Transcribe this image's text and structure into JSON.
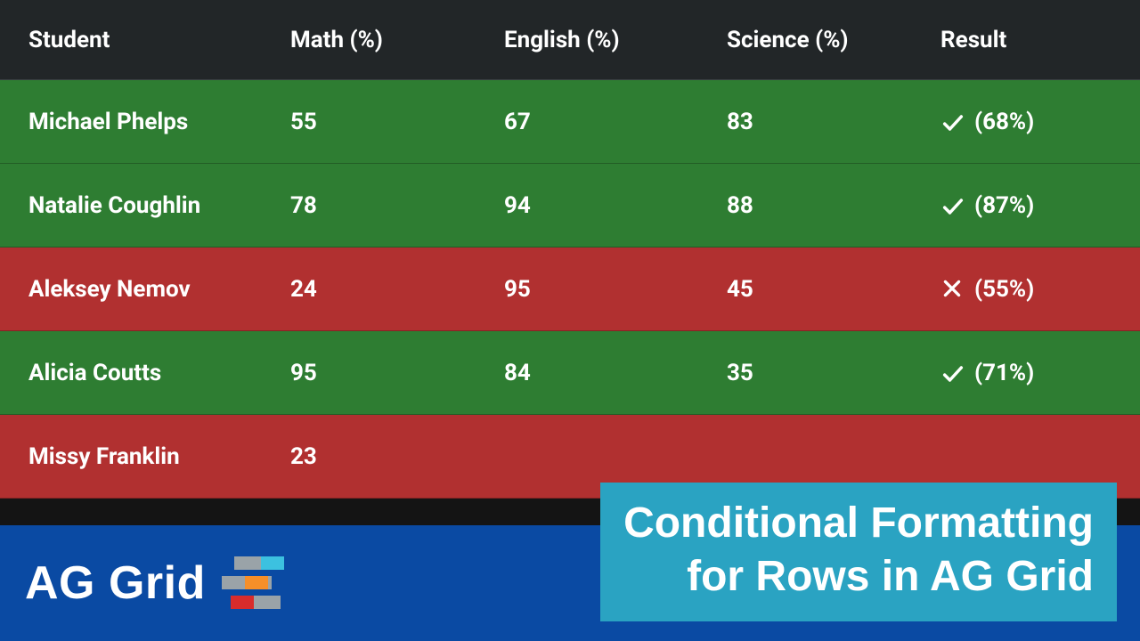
{
  "grid": {
    "columns": {
      "student": "Student",
      "math": "Math (%)",
      "english": "English (%)",
      "science": "Science (%)",
      "result": "Result"
    },
    "rows": [
      {
        "student": "Michael Phelps",
        "math": "55",
        "english": "67",
        "science": "83",
        "result_pct": "(68%)",
        "status": "pass"
      },
      {
        "student": "Natalie Coughlin",
        "math": "78",
        "english": "94",
        "science": "88",
        "result_pct": "(87%)",
        "status": "pass"
      },
      {
        "student": "Aleksey Nemov",
        "math": "24",
        "english": "95",
        "science": "45",
        "result_pct": "(55%)",
        "status": "fail"
      },
      {
        "student": "Alicia Coutts",
        "math": "95",
        "english": "84",
        "science": "35",
        "result_pct": "(71%)",
        "status": "pass"
      },
      {
        "student": "Missy Franklin",
        "math": "23",
        "english": "",
        "science": "",
        "result_pct": "",
        "status": "fail"
      }
    ]
  },
  "footer": {
    "brand": "AG Grid"
  },
  "title_card": {
    "line1": "Conditional Formatting",
    "line2": "for Rows in AG Grid"
  },
  "colors": {
    "pass": "#2e7d32",
    "fail": "#b13030",
    "header": "#222628",
    "footer": "#0a4aa3",
    "card": "#2aa3c2"
  }
}
